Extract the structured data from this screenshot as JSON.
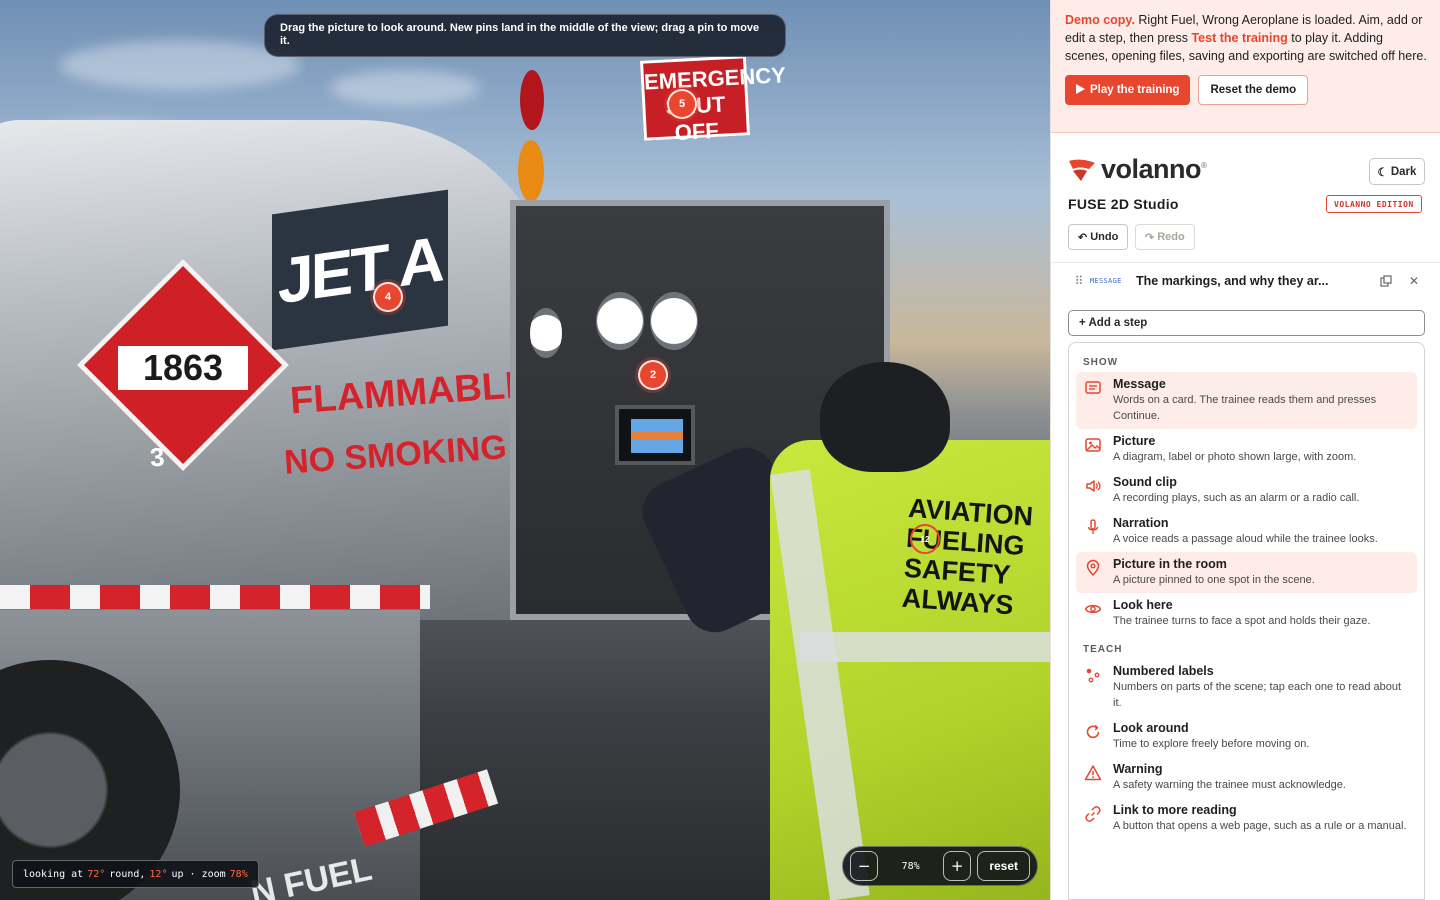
{
  "viewer": {
    "hint": "Drag the picture to look around. New pins land in the middle of the view; drag a pin to move it.",
    "scene_text": {
      "jet_a": "JET A",
      "placard_number": "1863",
      "placard_class": "3",
      "flammable": "FLAMMABLE",
      "no_smoking": "NO SMOKING",
      "emergency": "EMERGENCY SHUT OFF",
      "vest": "AVIATION FUELING SAFETY ALWAYS",
      "fuel": "N FUEL"
    },
    "pins": [
      {
        "label": "4",
        "target": "JET A sign"
      },
      {
        "label": "5",
        "target": "Emergency shut-off"
      },
      {
        "label": "2",
        "target": "Gauge panel"
      },
      {
        "label": "12",
        "target": "Vest text",
        "ghost": true
      }
    ],
    "readout": {
      "prefix": "looking at",
      "round": "72°",
      "round_label": "round,",
      "up": "12°",
      "up_label": "up · zoom",
      "zoom": "78%"
    },
    "zoom": {
      "minus": "−",
      "value": "78%",
      "plus": "+",
      "reset": "reset"
    }
  },
  "demo": {
    "lead": "Demo copy.",
    "text1": " Right Fuel, Wrong Aeroplane is loaded. Aim, add or edit a step, then press ",
    "link": "Test the training",
    "text2": " to play it. Adding scenes, opening files, saving and exporting are switched off here.",
    "play_button": "Play the training",
    "reset_button": "Reset the demo"
  },
  "header": {
    "brand": "volanno",
    "brand_mark": "®",
    "dark_button": "Dark",
    "studio_title": "FUSE 2D Studio",
    "edition": "VOLANNO EDITION",
    "undo": "Undo",
    "redo": "Redo"
  },
  "steps": [
    {
      "type": "MESSAGE",
      "title": "The markings, and why they ar..."
    }
  ],
  "add_step": "+ Add a step",
  "menu": {
    "groups": [
      {
        "label": "SHOW",
        "items": [
          {
            "icon": "message-icon",
            "title": "Message",
            "desc": "Words on a card. The trainee reads them and presses Continue.",
            "highlighted": true
          },
          {
            "icon": "picture-icon",
            "title": "Picture",
            "desc": "A diagram, label or photo shown large, with zoom."
          },
          {
            "icon": "speaker-icon",
            "title": "Sound clip",
            "desc": "A recording plays, such as an alarm or a radio call."
          },
          {
            "icon": "microphone-icon",
            "title": "Narration",
            "desc": "A voice reads a passage aloud while the trainee looks."
          },
          {
            "icon": "map-pin-icon",
            "title": "Picture in the room",
            "desc": "A picture pinned to one spot in the scene.",
            "highlighted": true
          },
          {
            "icon": "eye-icon",
            "title": "Look here",
            "desc": "The trainee turns to face a spot and holds their gaze."
          }
        ]
      },
      {
        "label": "TEACH",
        "items": [
          {
            "icon": "numbered-dots-icon",
            "title": "Numbered labels",
            "desc": "Numbers on parts of the scene; tap each one to read about it."
          },
          {
            "icon": "rotate-icon",
            "title": "Look around",
            "desc": "Time to explore freely before moving on."
          },
          {
            "icon": "warning-icon",
            "title": "Warning",
            "desc": "A safety warning the trainee must acknowledge."
          },
          {
            "icon": "link-icon",
            "title": "Link to more reading",
            "desc": "A button that opens a web page, such as a rule or a manual."
          }
        ]
      }
    ]
  },
  "colors": {
    "accent": "#e8462f",
    "demo_bg": "#fdece8",
    "step_type": "#3b6fc4",
    "vest": "#c9e83e"
  }
}
